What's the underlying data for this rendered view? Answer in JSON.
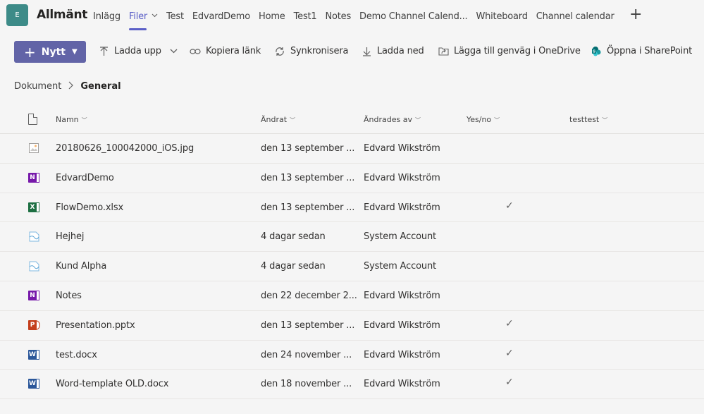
{
  "team": {
    "avatar_letter": "E",
    "channel_name": "Allmänt"
  },
  "tabs": [
    {
      "label": "Inlägg",
      "active": false
    },
    {
      "label": "Filer",
      "active": true
    },
    {
      "label": "Test",
      "active": false
    },
    {
      "label": "EdvardDemo",
      "active": false
    },
    {
      "label": "Home",
      "active": false
    },
    {
      "label": "Test1",
      "active": false
    },
    {
      "label": "Notes",
      "active": false
    },
    {
      "label": "Demo Channel Calend...",
      "active": false
    },
    {
      "label": "Whiteboard",
      "active": false
    },
    {
      "label": "Channel calendar",
      "active": false
    }
  ],
  "toolbar": {
    "new_label": "Nytt",
    "upload_label": "Ladda upp",
    "copy_link_label": "Kopiera länk",
    "sync_label": "Synkronisera",
    "download_label": "Ladda ned",
    "add_shortcut_label": "Lägga till genväg i OneDrive",
    "open_sharepoint_label": "Öppna i SharePoint"
  },
  "breadcrumb": {
    "root": "Dokument",
    "current": "General"
  },
  "columns": {
    "name": "Namn",
    "modified": "Ändrat",
    "modified_by": "Ändrades av",
    "yes_no": "Yes/no",
    "testtest": "testtest"
  },
  "files": [
    {
      "type": "image",
      "name": "20180626_100042000_iOS.jpg",
      "modified": "den 13 september ...",
      "modified_by": "Edvard Wikström",
      "yes_no": ""
    },
    {
      "type": "onenote",
      "name": "EdvardDemo",
      "modified": "den 13 september ...",
      "modified_by": "Edvard Wikström",
      "yes_no": ""
    },
    {
      "type": "excel",
      "name": "FlowDemo.xlsx",
      "modified": "den 13 september ...",
      "modified_by": "Edvard Wikström",
      "yes_no": "✓"
    },
    {
      "type": "chart",
      "name": "Hejhej",
      "modified": "4 dagar sedan",
      "modified_by": "System Account",
      "yes_no": ""
    },
    {
      "type": "chart",
      "name": "Kund Alpha",
      "modified": "4 dagar sedan",
      "modified_by": "System Account",
      "yes_no": ""
    },
    {
      "type": "onenote",
      "name": "Notes",
      "modified": "den 22 december 2...",
      "modified_by": "Edvard Wikström",
      "yes_no": ""
    },
    {
      "type": "ppt",
      "name": "Presentation.pptx",
      "modified": "den 13 september ...",
      "modified_by": "Edvard Wikström",
      "yes_no": "✓"
    },
    {
      "type": "word",
      "name": "test.docx",
      "modified": "den 24 november ...",
      "modified_by": "Edvard Wikström",
      "yes_no": "✓"
    },
    {
      "type": "word",
      "name": "Word-template OLD.docx",
      "modified": "den 18 november ...",
      "modified_by": "Edvard Wikström",
      "yes_no": "✓"
    }
  ]
}
